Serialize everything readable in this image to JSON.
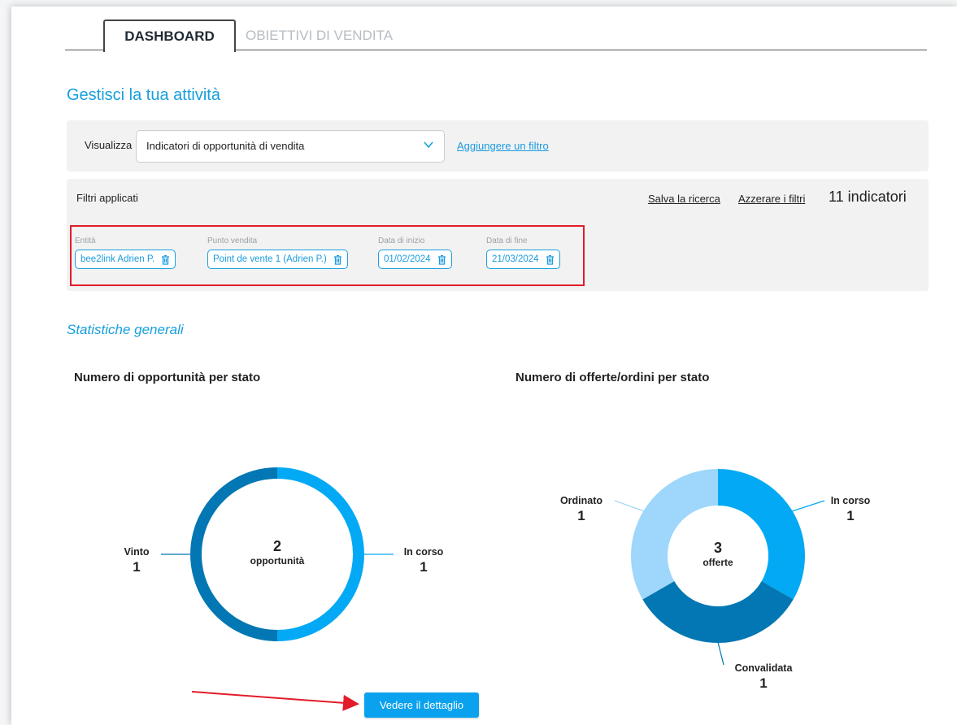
{
  "tabs": [
    {
      "label": "DASHBOARD",
      "active": true
    },
    {
      "label": "OBIETTIVI DI VENDITA",
      "active": false
    }
  ],
  "page_title": "Gestisci la tua attività",
  "view_bar": {
    "label": "Visualizza",
    "selected": "Indicatori di opportunità di vendita",
    "add_filter": "Aggiungere un filtro"
  },
  "applied_filters": {
    "title": "Filtri applicati",
    "save_search": "Salva la ricerca",
    "reset_filters": "Azzerare i filtri",
    "count_label": "11 indicatori",
    "chips": [
      {
        "label": "Entità",
        "value": "bee2link Adrien P."
      },
      {
        "label": "Punto vendita",
        "value": "Point de vente 1 (Adrien P.)"
      },
      {
        "label": "Data di inizio",
        "value": "01/02/2024"
      },
      {
        "label": "Data di fine",
        "value": "21/03/2024"
      }
    ]
  },
  "section_title": "Statistiche generali",
  "colors": {
    "accent": "#159fdd",
    "slice_light": "#03a9f4",
    "slice_dark": "#0277b3",
    "slice_pale": "#9fd6fb",
    "highlight_red": "#e21c2a"
  },
  "chart_data": [
    {
      "type": "pie",
      "title": "Numero di opportunità per stato",
      "center_value": "2",
      "center_label": "opportunità",
      "slices": [
        {
          "name": "In corso",
          "value": 1,
          "color": "#03a9f4"
        },
        {
          "name": "Vinto",
          "value": 1,
          "color": "#0277b3"
        }
      ]
    },
    {
      "type": "pie",
      "title": "Numero di offerte/ordini per stato",
      "center_value": "3",
      "center_label": "offerte",
      "slices": [
        {
          "name": "In corso",
          "value": 1,
          "color": "#03a9f4"
        },
        {
          "name": "Convalidata",
          "value": 1,
          "color": "#0277b3"
        },
        {
          "name": "Ordinato",
          "value": 1,
          "color": "#9fd6fb"
        }
      ]
    }
  ],
  "detail_button": "Vedere il dettaglio"
}
